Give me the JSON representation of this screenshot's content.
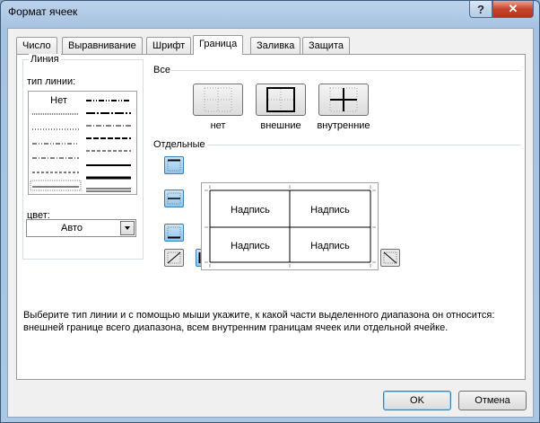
{
  "title": "Формат ячеек",
  "help_label": "?",
  "close_label": "✕",
  "tabs": [
    "Число",
    "Выравнивание",
    "Шрифт",
    "Граница",
    "Заливка",
    "Защита"
  ],
  "active_tab": "Граница",
  "line": {
    "section": "Линия",
    "style_label": "тип линии:",
    "none": "Нет",
    "color_label": "цвет:",
    "color_value": "Авто"
  },
  "presets": {
    "section": "Все",
    "none": "нет",
    "outline": "внешние",
    "inside": "внутренние"
  },
  "border": {
    "section": "Отдельные",
    "cells": [
      "Надпись",
      "Надпись",
      "Надпись",
      "Надпись"
    ]
  },
  "description": "Выберите тип линии и с помощью мыши укажите, к какой части выделенного диапазона он относится: внешней границе всего диапазона, всем внутренним границам ячеек или отдельной ячейке.",
  "buttons": {
    "ok": "OK",
    "cancel": "Отмена"
  },
  "colors": {
    "titlebar": "#a7c2e0",
    "accent_button": "#8fc6ee",
    "close": "#c7442c"
  }
}
